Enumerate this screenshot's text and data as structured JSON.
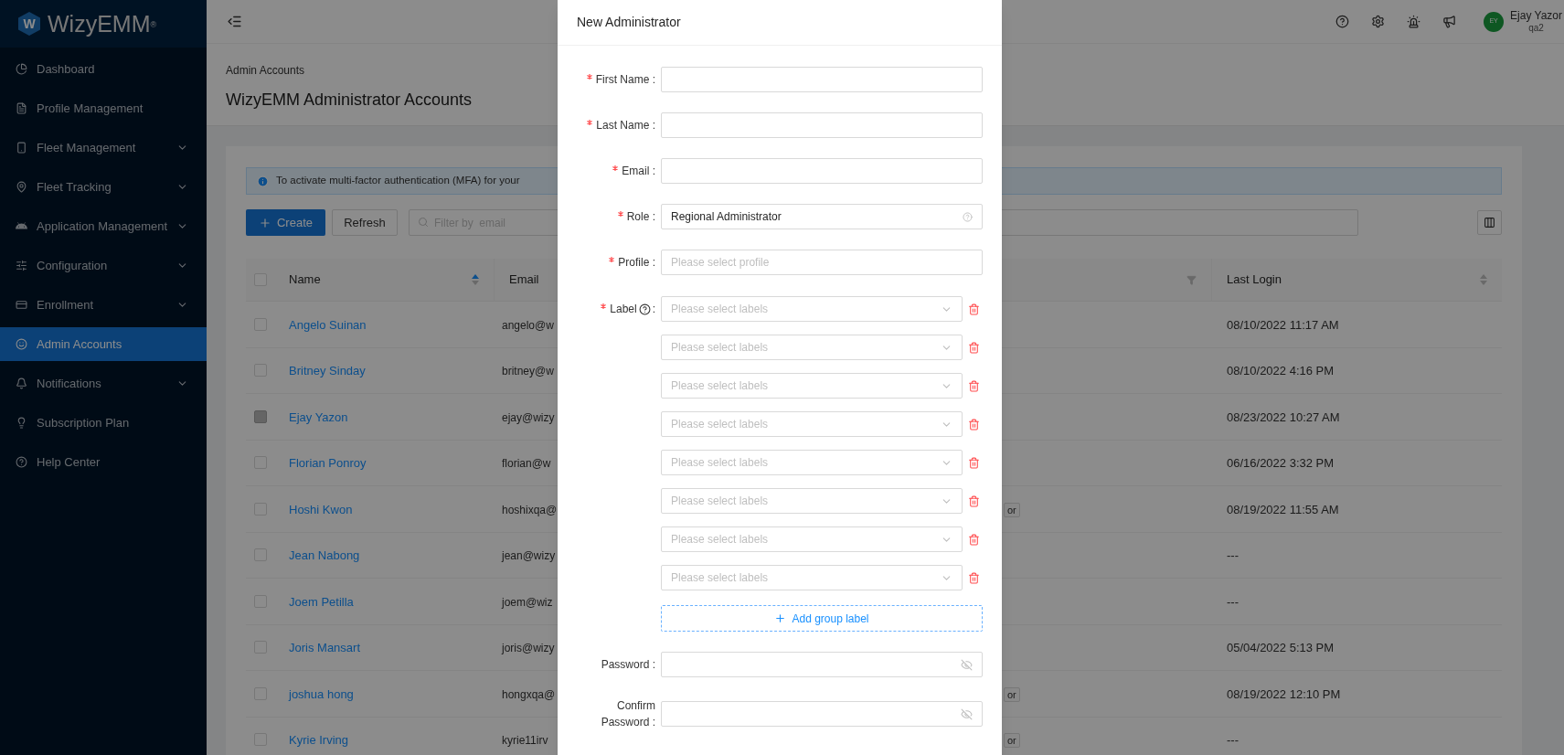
{
  "sidebar": {
    "logo_mark": "W",
    "logo_text": "WizyEMM$^{®}$",
    "items": [
      {
        "label": "Dashboard",
        "expandable": false,
        "selected": false
      },
      {
        "label": "Profile Management",
        "expandable": false,
        "selected": false
      },
      {
        "label": "Fleet Management",
        "expandable": true,
        "selected": false
      },
      {
        "label": "Fleet Tracking",
        "expandable": true,
        "selected": false
      },
      {
        "label": "Application Management",
        "expandable": true,
        "selected": false
      },
      {
        "label": "Configuration",
        "expandable": true,
        "selected": false
      },
      {
        "label": "Enrollment",
        "expandable": true,
        "selected": false
      },
      {
        "label": "Admin Accounts",
        "expandable": false,
        "selected": true
      },
      {
        "label": "Notifications",
        "expandable": true,
        "selected": false
      },
      {
        "label": "Subscription Plan",
        "expandable": false,
        "selected": false
      },
      {
        "label": "Help Center",
        "expandable": false,
        "selected": false
      }
    ]
  },
  "header": {
    "user": {
      "initials": "EY",
      "name": "Ejay Yazor",
      "org": "qa2"
    }
  },
  "breadcrumb": "Admin Accounts",
  "page_title": "WizyEMM Administrator Accounts",
  "banner": "To activate multi-factor authentication (MFA) for your",
  "toolbar": {
    "create": "Create",
    "refresh": "Refresh",
    "filter_placeholder": "Filter by  email"
  },
  "table": {
    "select_all_checked": false,
    "columns": [
      {
        "label": "Name",
        "sortable": true,
        "filterable": false
      },
      {
        "label": "Email"
      },
      {
        "sortable": false,
        "filterable": true
      },
      {
        "label": "Last Login",
        "sortable": true,
        "filterable": false
      }
    ],
    "rows": [
      {
        "name": "Angelo Suinan",
        "email": "angelo@w",
        "last_login": "08/10/2022 11:17 AM",
        "checked": false,
        "disabled": false
      },
      {
        "name": "Britney Sinday",
        "email": "britney@w",
        "last_login": "08/10/2022 4:16 PM",
        "checked": false,
        "disabled": false
      },
      {
        "name": "Ejay Yazon",
        "email": "ejay@wizy",
        "last_login": "08/23/2022 10:27 AM",
        "checked": false,
        "disabled": true
      },
      {
        "name": "Florian Ponroy",
        "email": "florian@w",
        "last_login": "06/16/2022 3:32 PM",
        "checked": false,
        "disabled": false
      },
      {
        "name": "Hoshi Kwon",
        "email": "hoshixqa@",
        "tag": "or",
        "last_login": "08/19/2022 11:55 AM",
        "checked": false,
        "disabled": false
      },
      {
        "name": "Jean Nabong",
        "email": "jean@wizy",
        "last_login": "---",
        "checked": false,
        "disabled": false
      },
      {
        "name": "Joem Petilla",
        "email": "joem@wiz",
        "last_login": "---",
        "checked": false,
        "disabled": false
      },
      {
        "name": "Joris Mansart",
        "email": "joris@wizy",
        "last_login": "05/04/2022 5:13 PM",
        "checked": false,
        "disabled": false
      },
      {
        "name": "joshua hong",
        "email": "hongxqa@",
        "tag": "or",
        "last_login": "08/19/2022 12:10 PM",
        "checked": false,
        "disabled": false
      },
      {
        "name": "Kyrie Irving",
        "email": "kyrie11irv",
        "tag": "or",
        "last_login": "---",
        "checked": false,
        "disabled": false
      }
    ]
  },
  "modal": {
    "title": "New Administrator",
    "fields": [
      {
        "kind": "text",
        "label": "First Name :",
        "required": true
      },
      {
        "kind": "text",
        "label": "Last Name :",
        "required": true
      },
      {
        "kind": "text",
        "label": "Email :",
        "required": true
      },
      {
        "kind": "select",
        "label": "Role :",
        "required": true,
        "value": "Regional Administrator",
        "hint": true
      },
      {
        "kind": "select",
        "label": "Profile :",
        "required": true,
        "placeholder": "Please select profile",
        "hint": false
      },
      {
        "kind": "labels",
        "label": "Label",
        "label_suffix": ":",
        "required": true,
        "help": true,
        "add_button": "Add group label",
        "selects": [
          {
            "placeholder": "Please select labels"
          },
          {
            "placeholder": "Please select labels"
          },
          {
            "placeholder": "Please select labels"
          },
          {
            "placeholder": "Please select labels"
          },
          {
            "placeholder": "Please select labels"
          },
          {
            "placeholder": "Please select labels"
          },
          {
            "placeholder": "Please select labels"
          },
          {
            "placeholder": "Please select labels"
          }
        ]
      },
      {
        "kind": "password",
        "label": "Password :",
        "required": false
      },
      {
        "kind": "password",
        "label": "Confirm Password :",
        "required": false
      }
    ]
  }
}
